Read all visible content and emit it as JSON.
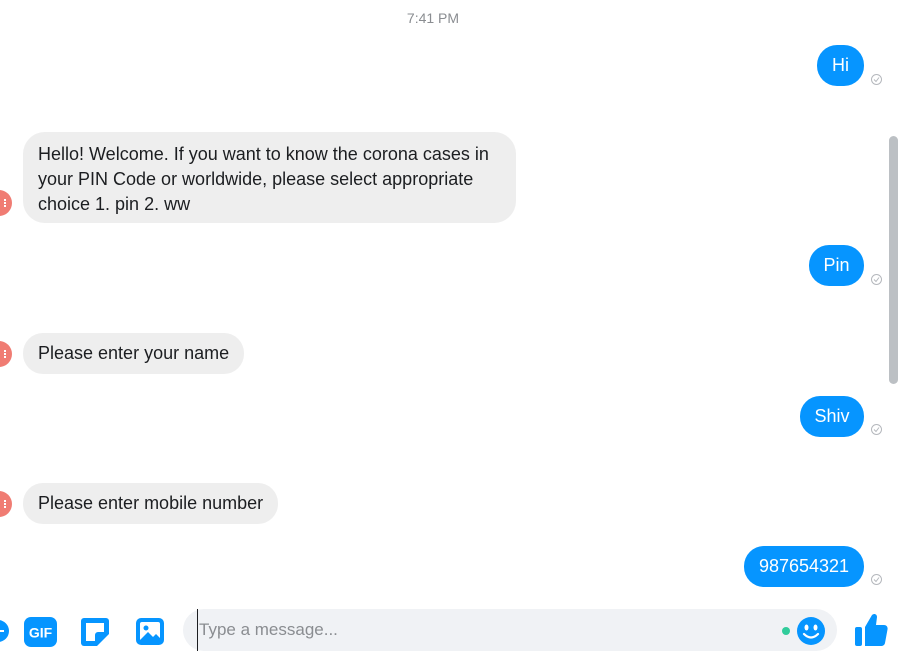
{
  "thread": {
    "timestamp": "7:41 PM",
    "messages": [
      {
        "sender": "me",
        "text": "Hi"
      },
      {
        "sender": "bot",
        "text": "Hello! Welcome. If you want to know the corona cases in your PIN Code or worldwide, please select appropriate choice  1. pin  2. ww"
      },
      {
        "sender": "me",
        "text": "Pin"
      },
      {
        "sender": "bot",
        "text": "Please enter your name"
      },
      {
        "sender": "me",
        "text": "Shiv"
      },
      {
        "sender": "bot",
        "text": "Please enter mobile number"
      },
      {
        "sender": "me",
        "text": "987654321"
      }
    ]
  },
  "composer": {
    "placeholder": "Type a message...",
    "icons": [
      "plus-circle-icon",
      "gif-icon",
      "sticker-icon",
      "image-icon",
      "emoji-icon",
      "thumbs-up-icon"
    ]
  },
  "colors": {
    "outgoing_bubble": "#0695ff",
    "incoming_bubble": "#eeeeee",
    "avatar": "#f07c73",
    "icon_blue": "#0695ff",
    "online": "#31cc9b"
  }
}
